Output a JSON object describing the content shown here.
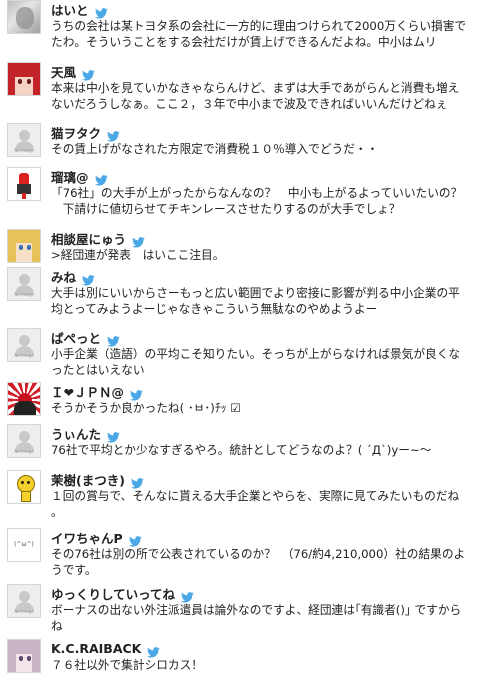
{
  "colors": {
    "bird": "#4aa8e6",
    "name": "#222222",
    "text": "#222222"
  },
  "tweets": [
    {
      "name": "はいと",
      "avatar": "photo-grey",
      "lines": [
        "うちの会社は某トヨタ系の会社に一方的に理由つけられて2000万くらい損害で",
        "たわ。そういうことをする会社だけが賃上げできるんだよね。中小はムリ"
      ]
    },
    {
      "name": "天風",
      "avatar": "anime-red",
      "lines": [
        "本来は中小を見ていかなきゃならんけど、まずは大手であがらんと消費も増え",
        "ないだろうしなぁ。ここ２，３年で中小まで波及できればいいんだけどねぇ"
      ]
    },
    {
      "name": "猫ヲタク",
      "avatar": "no-image",
      "lines": [
        "その賃上げがなされた方限定で消費税１０％導入でどうだ・・"
      ]
    },
    {
      "name": "瑠璃@",
      "avatar": "robot",
      "lines": [
        "「76社」の大手が上がったからなんなの？　中小も上がるよっていいたいの？",
        "　下請けに値切らせてチキンレースさせたりするのが大手でしょ？"
      ]
    },
    {
      "name": "相談屋にゅう",
      "avatar": "anime-blonde",
      "lines": [
        ">経団連が発表　はいここ注目。"
      ]
    },
    {
      "name": "みね",
      "avatar": "no-image",
      "lines": [
        "大手は別にいいからさーもっと広い範囲でより密接に影響が判る中小企業の平",
        "均とってみようよーじゃなきゃこういう無駄なのやめようよー"
      ]
    },
    {
      "name": "ぱぺっと",
      "avatar": "no-image",
      "lines": [
        "小手企業（造語）の平均こそ知りたい。そっちが上がらなければ景気が良くな",
        "ったとはいえない"
      ]
    },
    {
      "name": "Ｉ❤ＪＰＮ@",
      "avatar": "flag",
      "lines": [
        "そうかそうか良かったね( ･ㅂ･)ﾁｯ ☑"
      ]
    },
    {
      "name": "うぃんた",
      "avatar": "no-image",
      "lines": [
        "76社で平均とか少なすぎるやろ。統計としてどうなのよ？( ´Д`)yー~～"
      ]
    },
    {
      "name": "茉樹(まつき)",
      "avatar": "yellow-char",
      "lines": [
        "１回の賞与で、そんなに貰える大手企業とやらを、実際に見てみたいものだね",
        "。"
      ]
    },
    {
      "name": "イワちゃんP",
      "avatar": "face-text",
      "avatar_text": "(^ω^)",
      "lines": [
        "その76社は別の所で公表されているのか？　（76/約4,210,000）社の結果のよ",
        "うです。"
      ]
    },
    {
      "name": "ゆっくりしていってね",
      "avatar": "no-image",
      "lines": [
        "ボーナスの出ない外注派遣員は論外なのですよ、経団連は｢有識者()｣ ですから",
        "ね"
      ]
    },
    {
      "name": "K.C.RAIBACK",
      "avatar": "anime-pink",
      "lines": [
        "７６社以外で集計シロカス！"
      ]
    }
  ]
}
